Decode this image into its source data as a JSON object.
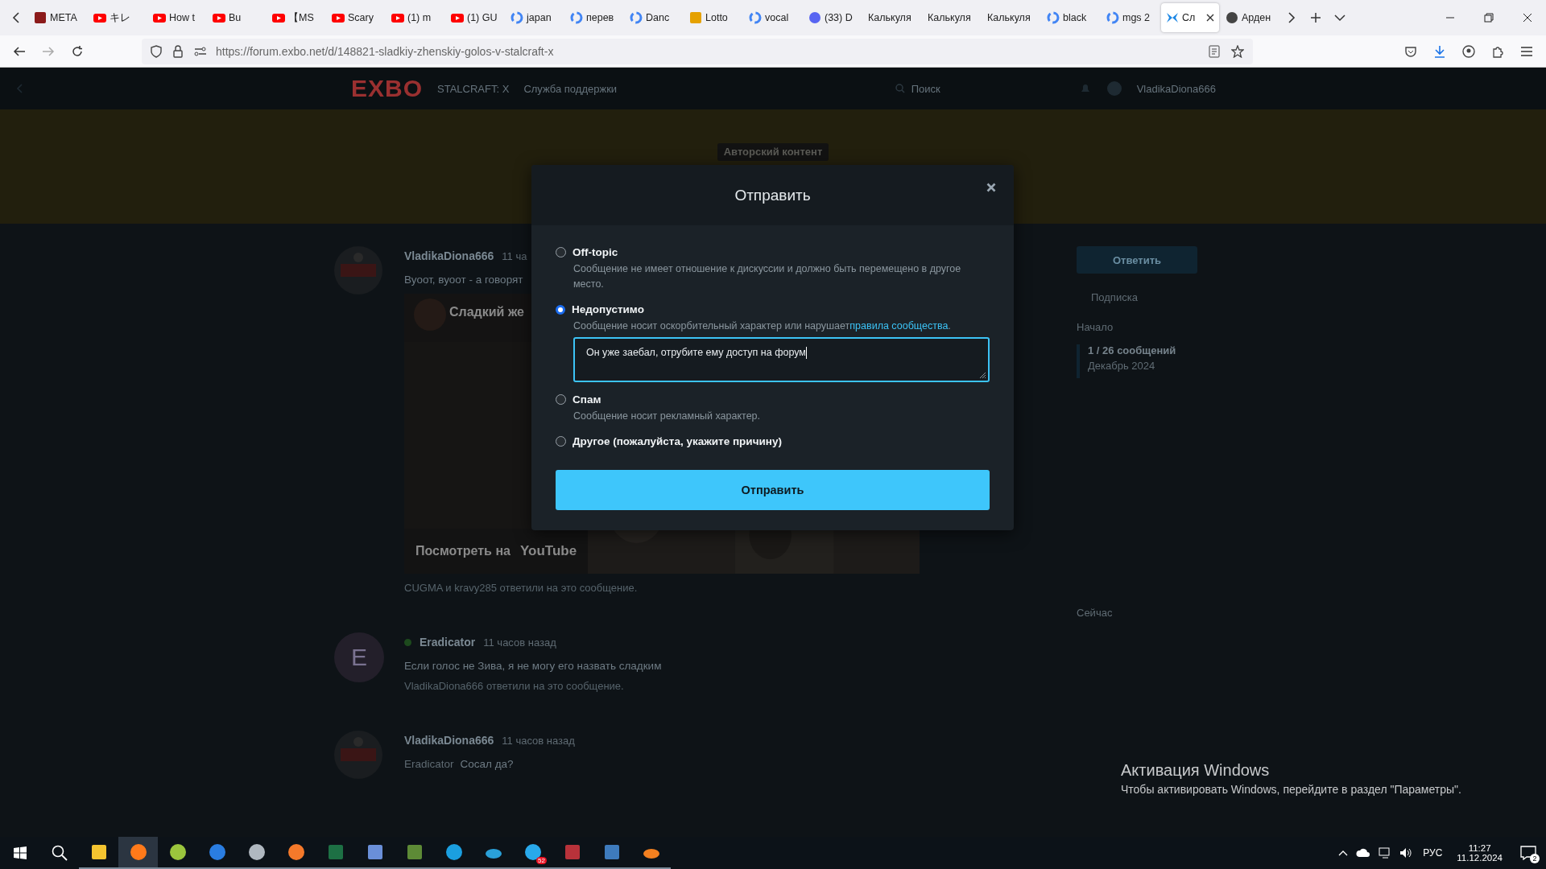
{
  "browser": {
    "tabs": [
      {
        "label": "META",
        "kind": "meta",
        "selected": false
      },
      {
        "label": "キレ",
        "kind": "youtube",
        "selected": false
      },
      {
        "label": "How t",
        "kind": "youtube",
        "selected": false
      },
      {
        "label": "Bu",
        "kind": "youtube",
        "selected": false
      },
      {
        "label": "【MS",
        "kind": "youtube",
        "selected": false
      },
      {
        "label": "Scary",
        "kind": "youtube",
        "selected": false
      },
      {
        "label": "(1) m",
        "kind": "youtube",
        "selected": false
      },
      {
        "label": "(1) GU",
        "kind": "youtube",
        "selected": false
      },
      {
        "label": "japan",
        "kind": "google",
        "selected": false
      },
      {
        "label": "перев",
        "kind": "google",
        "selected": false
      },
      {
        "label": "Danc",
        "kind": "google",
        "selected": false
      },
      {
        "label": "Lotto",
        "kind": "gift",
        "selected": false
      },
      {
        "label": "vocal",
        "kind": "google",
        "selected": false
      },
      {
        "label": "(33) D",
        "kind": "badge",
        "selected": false
      },
      {
        "label": "Калькуля",
        "kind": "none",
        "selected": false
      },
      {
        "label": "Калькуля",
        "kind": "none",
        "selected": false
      },
      {
        "label": "Калькуля",
        "kind": "none",
        "selected": false
      },
      {
        "label": "black",
        "kind": "google",
        "selected": false
      },
      {
        "label": "mgs 2",
        "kind": "google",
        "selected": false
      },
      {
        "label": "Сл",
        "kind": "exbo",
        "selected": true
      },
      {
        "label": "Арден",
        "kind": "wiki",
        "selected": false
      }
    ],
    "url_host": "https://forum.exbo.net",
    "url_path": "/d/148821-sladkiy-zhenskiy-golos-v-stalcraft-x"
  },
  "forum": {
    "logo": "EXBO",
    "nav": [
      "STALCRAFT: X",
      "Служба поддержки"
    ],
    "search_placeholder": "Поиск",
    "user": "VladikaDiona666",
    "banner": "Авторский контент",
    "posts": [
      {
        "author": "VladikaDiona666",
        "time": "11 ча",
        "text": "Вуоот, вуоот - а говорят",
        "video": {
          "title": "Сладкий же",
          "watch": "Посмотреть на",
          "brand": "YouTube"
        },
        "replies": "CUGMA и kravy285 ответили на это сообщение."
      },
      {
        "author": "Eradicator",
        "time": "11 часов назад",
        "initial": "E",
        "online": true,
        "text": "Если голос не Зива, я не могу его назвать сладким",
        "replies": "VladikaDiona666 ответили на это сообщение."
      },
      {
        "author": "VladikaDiona666",
        "time": "11 часов назад",
        "reply_to": "Eradicator",
        "text": "Сосал да?"
      }
    ],
    "sidebar": {
      "reply": "Ответить",
      "subscribe": "Подписка",
      "start": "Начало",
      "position": "1 / 26 сообщений",
      "date": "Декабрь 2024",
      "now": "Сейчас"
    }
  },
  "modal": {
    "title": "Отправить",
    "options": [
      {
        "label": "Off-topic",
        "description": "Сообщение не имеет отношение к дискуссии и должно быть перемещено в другое место.",
        "selected": false
      },
      {
        "label": "Недопустимо",
        "description": "Сообщение носит оскорбительный характер или нарушает",
        "link": "правила сообщества",
        "after": ".",
        "selected": true
      },
      {
        "label": "Спам",
        "description": "Сообщение носит рекламный характер.",
        "selected": false
      },
      {
        "label": "Другое (пожалуйста, укажите причину)",
        "selected": false
      }
    ],
    "reason": "Он уже заебал, отрубите ему доступ на форум",
    "submit": "Отправить"
  },
  "activation": {
    "title": "Активация Windows",
    "text": "Чтобы активировать Windows, перейдите в раздел \"Параметры\"."
  },
  "taskbar": {
    "apps": [
      {
        "kind": "folder",
        "active": false
      },
      {
        "kind": "firefox",
        "active": true
      },
      {
        "kind": "ball",
        "active": false
      },
      {
        "kind": "w",
        "active": false
      },
      {
        "kind": "globe",
        "active": false
      },
      {
        "kind": "blender",
        "active": false
      },
      {
        "kind": "excel",
        "active": false
      },
      {
        "kind": "cube",
        "active": false
      },
      {
        "kind": "block",
        "active": false
      },
      {
        "kind": "steam",
        "active": false
      },
      {
        "kind": "dolphin",
        "active": false
      },
      {
        "kind": "telegram",
        "active": false,
        "badge": "52"
      },
      {
        "kind": "archive",
        "active": false
      },
      {
        "kind": "calculator",
        "active": false
      },
      {
        "kind": "cloud",
        "active": false
      }
    ],
    "lang": "РУС",
    "time": "11:27",
    "date": "11.12.2024",
    "notifications": "2"
  }
}
